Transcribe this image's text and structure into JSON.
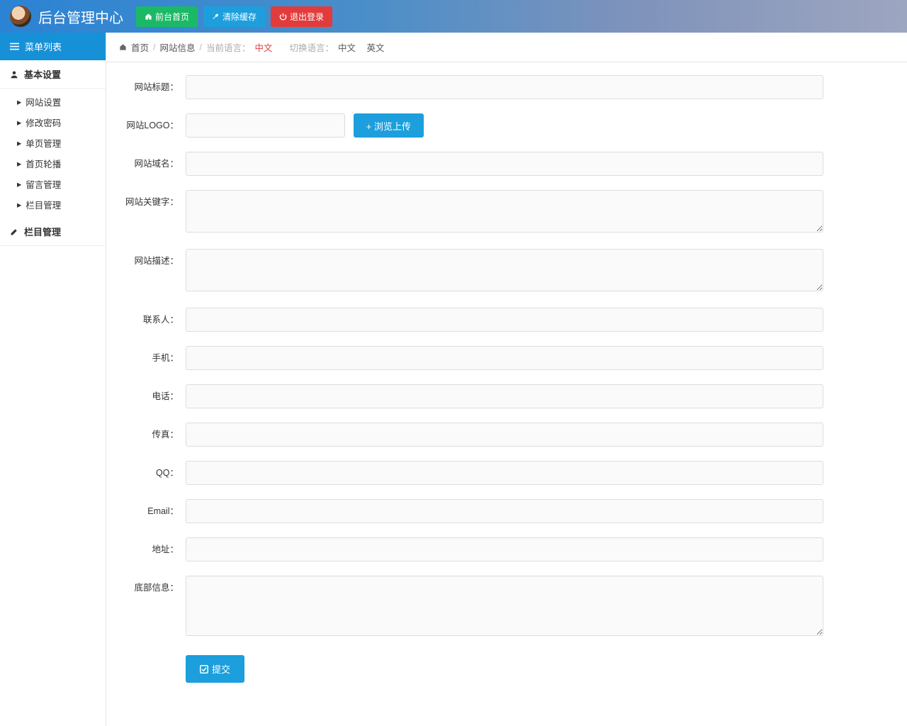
{
  "header": {
    "title": "后台管理中心",
    "btn_home": "前台首页",
    "btn_cache": "清除缓存",
    "btn_logout": "退出登录"
  },
  "sidebar": {
    "menu_header": "菜单列表",
    "section1": "基本设置",
    "items1": [
      "网站设置",
      "修改密码",
      "单页管理",
      "首页轮播",
      "留言管理",
      "栏目管理"
    ],
    "section2": "栏目管理"
  },
  "breadcrumb": {
    "home": "首页",
    "page": "网站信息",
    "cur_lang_label": "当前语言：",
    "cur_lang_value": "中文",
    "switch_label": "切换语言：",
    "lang_cn": "中文",
    "lang_en": "英文"
  },
  "form": {
    "labels": {
      "title": "网站标题：",
      "logo": "网站LOGO：",
      "upload": "+ 浏览上传",
      "domain": "网站域名：",
      "keywords": "网站关键字：",
      "desc": "网站描述：",
      "contact": "联系人：",
      "mobile": "手机：",
      "phone": "电话：",
      "fax": "传真：",
      "qq": "QQ：",
      "email": "Email：",
      "address": "地址：",
      "footer": "底部信息：",
      "submit": "提交"
    },
    "values": {
      "title": "",
      "logo": "",
      "domain": "",
      "keywords": "",
      "desc": "",
      "contact": "",
      "mobile": "",
      "phone": "",
      "fax": "",
      "qq": "",
      "email": "",
      "address": "",
      "footer": ""
    }
  }
}
